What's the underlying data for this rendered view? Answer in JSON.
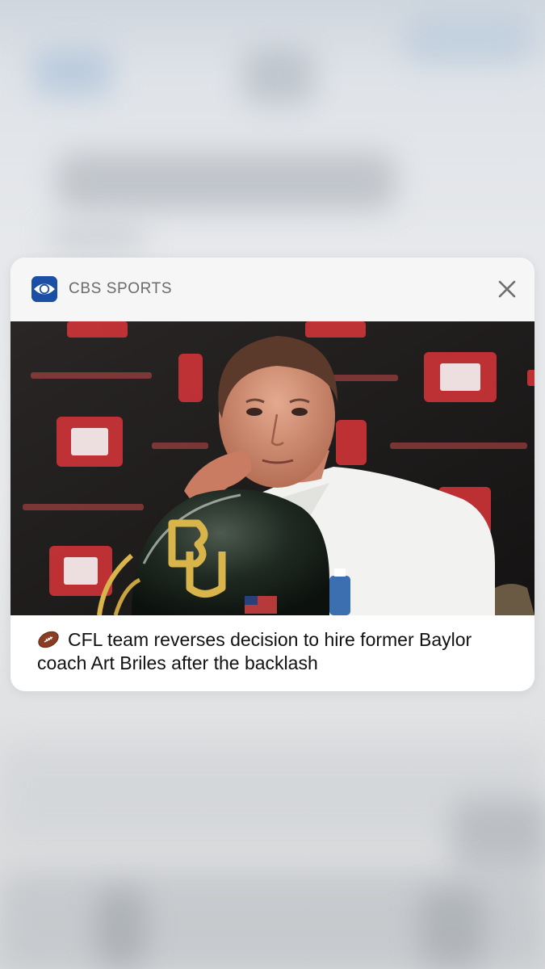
{
  "notification": {
    "app_name": "CBS SPORTS",
    "app_icon": "cbs-eye-icon",
    "close_icon": "close-icon",
    "image": "coach-press-conference-photo",
    "headline_emoji_icon": "american-football-icon",
    "headline": "CFL team reverses decision to hire former Baylor coach Art Briles after the backlash"
  },
  "colors": {
    "card_background": "#ffffff",
    "header_background": "#f6f6f6",
    "app_icon_blue": "#1b4fa6",
    "app_name_text": "#6b6b6b",
    "headline_text": "#111111"
  }
}
